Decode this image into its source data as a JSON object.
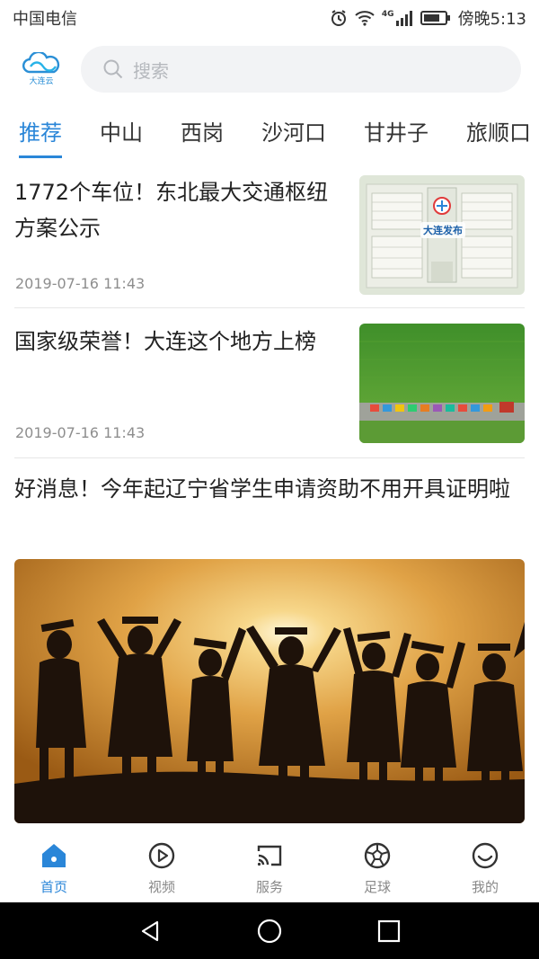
{
  "status_bar": {
    "carrier": "中国电信",
    "network": "4G",
    "time": "傍晚5:13",
    "icons": [
      "alarm-icon",
      "wifi-icon",
      "signal-icon",
      "battery-icon"
    ]
  },
  "header": {
    "logo_text": "大连云",
    "search_placeholder": "搜索"
  },
  "tabs": [
    {
      "label": "推荐",
      "active": true
    },
    {
      "label": "中山"
    },
    {
      "label": "西岗"
    },
    {
      "label": "沙河口"
    },
    {
      "label": "甘井子"
    },
    {
      "label": "旅顺口"
    }
  ],
  "articles": [
    {
      "title": "1772个车位！东北最大交通枢纽方案公示",
      "date": "2019-07-16 11:43",
      "thumb_caption": "大连发布"
    },
    {
      "title": "国家级荣誉！大连这个地方上榜",
      "date": "2019-07-16 11:43"
    },
    {
      "title": "好消息！今年起辽宁省学生申请资助不用开具证明啦"
    }
  ],
  "bottom_nav": [
    {
      "label": "首页",
      "icon": "home-icon",
      "active": true
    },
    {
      "label": "视频",
      "icon": "play-icon"
    },
    {
      "label": "服务",
      "icon": "cast-icon"
    },
    {
      "label": "足球",
      "icon": "soccer-ball-icon"
    },
    {
      "label": "我的",
      "icon": "smiley-icon"
    }
  ],
  "system_nav": [
    "back-icon",
    "home-circle-icon",
    "recents-icon"
  ],
  "colors": {
    "accent": "#2a86d8",
    "text": "#222222",
    "muted": "#8e8e8e"
  }
}
